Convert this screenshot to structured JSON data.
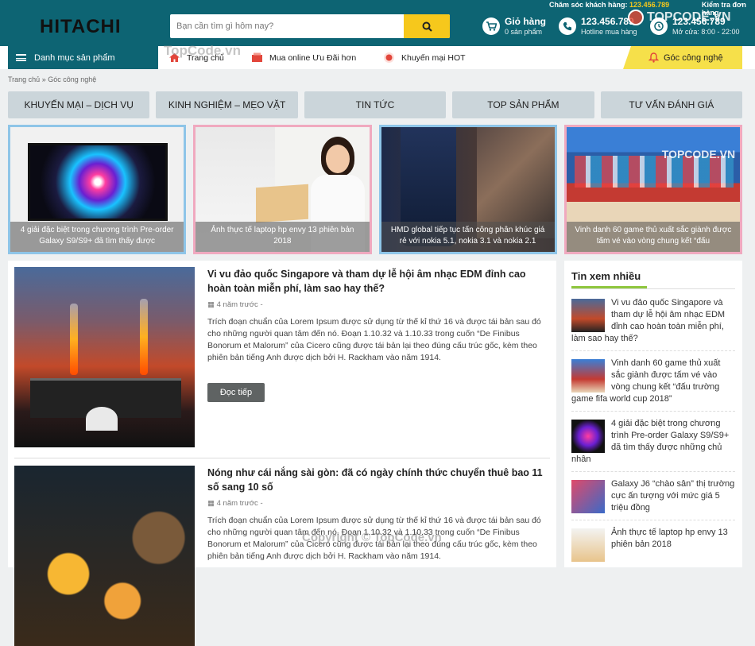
{
  "header": {
    "logo": "HITACHI",
    "search_placeholder": "Bạn cần tìm gì hôm nay?",
    "top_care_label": "Chăm sóc khách hàng:",
    "top_care_phone": "123.456.789",
    "top_order_check": "Kiểm tra đơn hàng",
    "cart_title": "Giỏ hàng",
    "cart_sub": "0 sản phẩm",
    "hotline_title": "123.456.789",
    "hotline_sub": "Hotline mua hàng",
    "store_title": "123.456.789",
    "store_sub": "Mở cửa: 8:00 - 22:00",
    "watermark": "TOPCODE.VN"
  },
  "nav": {
    "category": "Danh mục sản phẩm",
    "home": "Trang chủ",
    "online": "Mua online Ưu Đãi hơn",
    "promo": "Khuyến mại HOT",
    "tech": "Góc công nghệ",
    "watermark": "TopCode.vn"
  },
  "breadcrumb": "Trang chủ » Góc công nghệ",
  "tabs": [
    "KHUYẾN MẠI – DỊCH VỤ",
    "KINH NGHIỆM – MẸO VẶT",
    "TIN TỨC",
    "TOP SẢN PHẨM",
    "TƯ VẤN ĐÁNH GIÁ"
  ],
  "features": [
    {
      "caption": "4 giải đặc biệt trong chương trình Pre-order Galaxy S9/S9+ đã tìm thấy được",
      "border": "#8ec5e8"
    },
    {
      "caption": "Ảnh thực tế laptop hp envy 13 phiên bản 2018",
      "border": "#f0a9bf"
    },
    {
      "caption": "HMD global tiếp tục tấn công phân khúc giá rẻ với nokia 5.1, nokia 3.1 và nokia 2.1",
      "border": "#8ec5e8"
    },
    {
      "caption": "Vinh danh 60 game thủ xuất sắc giành được tấm vé vào vòng chung kết “đấu",
      "border": "#f0a9bf"
    }
  ],
  "posts": [
    {
      "title": "Vi vu đảo quốc Singapore và tham dự lễ hội âm nhạc EDM đỉnh cao hoàn toàn miễn phí, làm sao hay thế?",
      "date": "4 năm trước -",
      "desc": "Trích đoạn chuẩn của Lorem Ipsum được sử dụng từ thế kỉ thứ 16 và được tái bản sau đó cho những người quan tâm đến nó. Đoạn 1.10.32 và 1.10.33 trong cuốn “De Finibus Bonorum et Malorum” của Cicero cũng được tái bản lại theo đúng cấu trúc gốc, kèm theo phiên bản tiếng Anh được dịch bởi H. Rackham vào năm 1914.",
      "button": "Đọc tiếp"
    },
    {
      "title": "Nóng như cái nắng sài gòn: đã có ngày chính thức chuyển thuê bao 11 số sang 10 số",
      "date": "4 năm trước -",
      "desc": "Trích đoạn chuẩn của Lorem Ipsum được sử dụng từ thế kỉ thứ 16 và được tái bản sau đó cho những người quan tâm đến nó. Đoạn 1.10.32 và 1.10.33 trong cuốn “De Finibus Bonorum et Malorum” của Cicero cũng được tái bản lại theo đúng cấu trúc gốc, kèm theo phiên bản tiếng Anh được dịch bởi H. Rackham vào năm 1914."
    }
  ],
  "sidebar": {
    "title": "Tin xem nhiều",
    "items": [
      "Vi vu đảo quốc Singapore và tham dự lễ hội âm nhạc EDM đỉnh cao hoàn toàn miễn phí, làm sao hay thế?",
      "Vinh danh 60 game thủ xuất sắc giành được tấm vé vào vòng chung kết “đấu trường game fifa world cup 2018”",
      "4 giải đặc biệt trong chương trình Pre-order Galaxy S9/S9+ đã tìm thấy được những chủ nhân",
      "Galaxy J6 “chào sân” thị trường cực ấn tượng với mức giá 5 triệu đồng",
      "Ảnh thực tế laptop hp envy 13 phiên bản 2018"
    ]
  },
  "footer_watermark": "Copyright © TopCode.vn",
  "colors": {
    "brand": "#0d6473",
    "accent": "#f6c81c",
    "green": "#8fc73e"
  }
}
